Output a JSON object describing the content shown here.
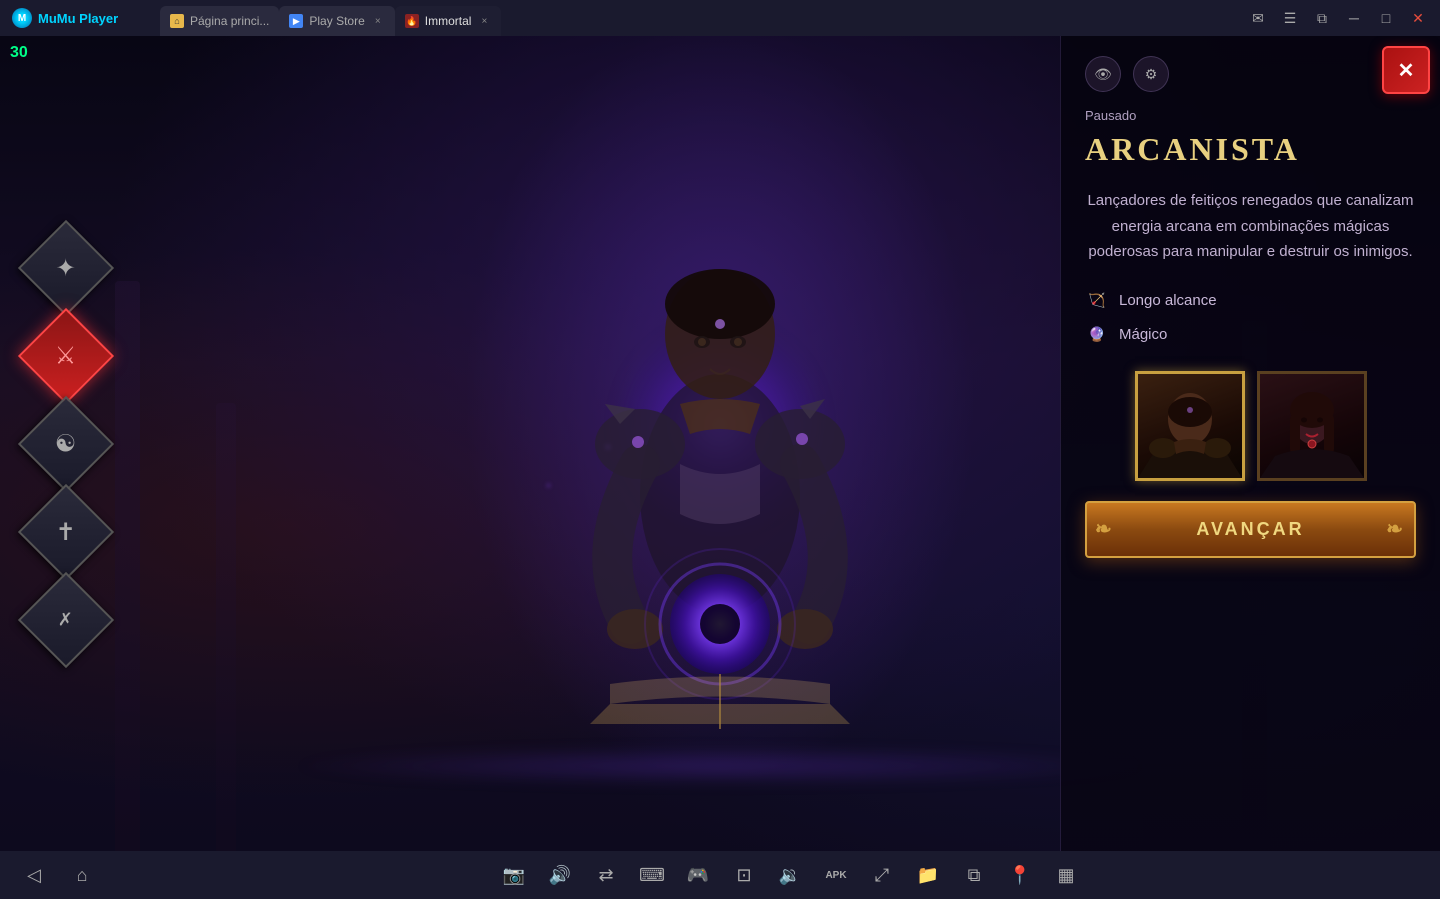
{
  "titlebar": {
    "logo_text": "MuMu Player",
    "tabs": [
      {
        "id": "home",
        "label": "Página princi...",
        "favicon_type": "home",
        "closable": false,
        "active": false
      },
      {
        "id": "playstore",
        "label": "Play Store",
        "favicon_type": "play",
        "closable": true,
        "active": false
      },
      {
        "id": "immortal",
        "label": "Immortal",
        "favicon_type": "game",
        "closable": true,
        "active": true
      }
    ],
    "actions": [
      "mail",
      "menu",
      "restore",
      "minimize",
      "maximize",
      "close"
    ]
  },
  "fps": "30",
  "game": {
    "class_icons": [
      {
        "id": "necromancer",
        "symbol": "✦",
        "active": false
      },
      {
        "id": "barbarian",
        "symbol": "⚔",
        "active": true
      },
      {
        "id": "wizard",
        "symbol": "☯",
        "active": false
      },
      {
        "id": "crusader",
        "symbol": "✝",
        "active": false
      },
      {
        "id": "demon_hunter",
        "symbol": "✗",
        "active": false
      }
    ]
  },
  "panel": {
    "paused_label": "Pausado",
    "class_name": "ARCANISTA",
    "description": "Lançadores de feitiços renegados que canalizam energia arcana em combinações mágicas poderosas para manipular e destruir os inimigos.",
    "traits": [
      {
        "icon": "🏹",
        "label": "Longo alcance"
      },
      {
        "icon": "🔮",
        "label": "Mágico"
      }
    ],
    "portraits": [
      {
        "id": "male",
        "label": "Male Arcanist",
        "selected": true
      },
      {
        "id": "female",
        "label": "Female Arcanist",
        "selected": false
      }
    ],
    "advance_button": "AVANÇAR",
    "panel_icons": [
      {
        "id": "eye",
        "symbol": "👁"
      },
      {
        "id": "gear",
        "symbol": "⚙"
      }
    ]
  },
  "taskbar": {
    "buttons": [
      {
        "id": "back",
        "symbol": "◁",
        "label": "back"
      },
      {
        "id": "home",
        "symbol": "⌂",
        "label": "home"
      },
      {
        "id": "camera",
        "symbol": "📷",
        "label": "camera"
      },
      {
        "id": "volume",
        "symbol": "🔊",
        "label": "volume"
      },
      {
        "id": "share",
        "symbol": "⇄",
        "label": "share"
      },
      {
        "id": "keyboard",
        "symbol": "⌨",
        "label": "keyboard"
      },
      {
        "id": "gamepad",
        "symbol": "🎮",
        "label": "gamepad"
      },
      {
        "id": "crop",
        "symbol": "⊡",
        "label": "crop"
      },
      {
        "id": "sound",
        "symbol": "🔉",
        "label": "sound"
      },
      {
        "id": "apk",
        "symbol": "APK",
        "label": "apk"
      },
      {
        "id": "resize",
        "symbol": "⤢",
        "label": "resize"
      },
      {
        "id": "folder",
        "symbol": "📁",
        "label": "folder"
      },
      {
        "id": "copy",
        "symbol": "⧉",
        "label": "copy"
      },
      {
        "id": "location",
        "symbol": "📍",
        "label": "location"
      },
      {
        "id": "layout",
        "symbol": "▦",
        "label": "layout"
      }
    ]
  }
}
